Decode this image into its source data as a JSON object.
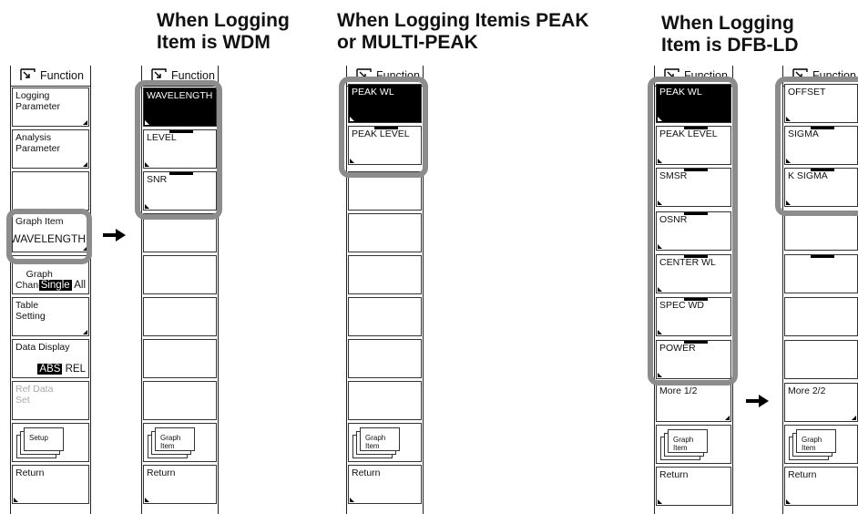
{
  "headings": {
    "wdm": "When Logging\nItem is WDM",
    "peak": "When Logging Itemis PEAK\nor MULTI-PEAK",
    "dfb": "When Logging\nItem is DFB-LD"
  },
  "function_label": "Function",
  "col1": {
    "logging_parameter": "Logging\nParameter",
    "analysis_parameter": "Analysis\nParameter",
    "graph_item_label": "Graph Item",
    "graph_item_value": "WAVELENGTH",
    "graph_channel_label": "Graph\nChannel",
    "graph_channel_single": "Single",
    "graph_channel_all": "All",
    "table_setting": "Table\nSetting",
    "data_display_label": "Data Display",
    "data_display_abs": "ABS",
    "data_display_rel": "REL",
    "ref_data_set": "Ref Data\nSet",
    "setup": "Setup",
    "return": "Return"
  },
  "col2": {
    "items": [
      "WAVELENGTH",
      "LEVEL",
      "SNR"
    ],
    "graph_item": "Graph\nItem",
    "return": "Return"
  },
  "col3": {
    "items": [
      "PEAK WL",
      "PEAK LEVEL"
    ],
    "graph_item": "Graph\nItem",
    "return": "Return"
  },
  "col4": {
    "items": [
      "PEAK WL",
      "PEAK LEVEL",
      "SMSR",
      "OSNR",
      "CENTER WL",
      "SPEC WD",
      "POWER"
    ],
    "more": "More 1/2",
    "graph_item": "Graph\nItem",
    "return": "Return"
  },
  "col5": {
    "items": [
      "OFFSET",
      "SIGMA",
      "K SIGMA"
    ],
    "more": "More 2/2",
    "graph_item": "Graph\nItem",
    "return": "Return"
  },
  "colors": {
    "highlight": "#8c8c8c",
    "selected_bg": "#000000",
    "disabled_text": "#aaaaaa"
  }
}
